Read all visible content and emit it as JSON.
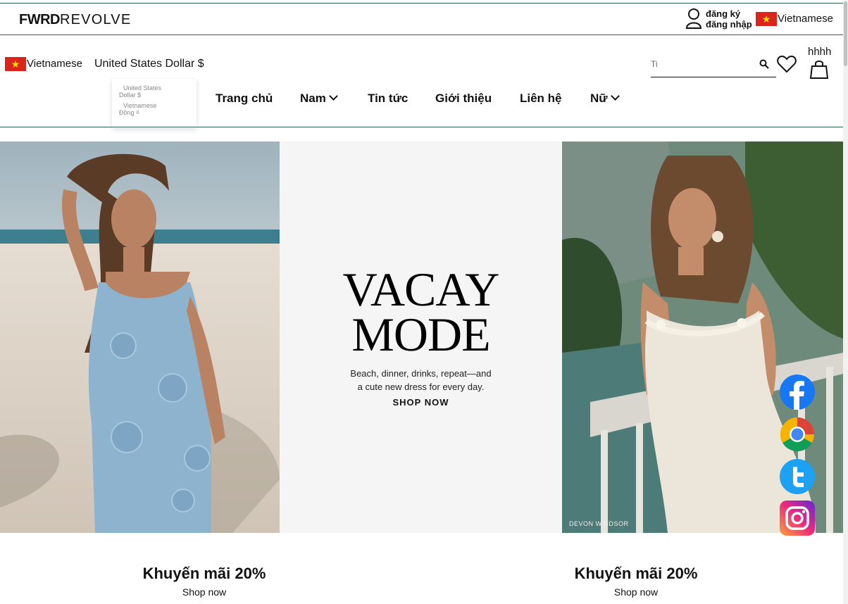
{
  "header": {
    "logo_bold": "FWRD",
    "logo_light": "REVOLVE",
    "register": "đăng ký",
    "login": "đăng nhập",
    "language": "Vietnamese"
  },
  "toolbar": {
    "language": "Vietnamese",
    "currency": "United States Dollar $",
    "currency_options": [
      "United States",
      "Dollar $",
      "Vietnamese",
      "Đồng ₫"
    ],
    "search_value": "Ti",
    "cart_name": "hhhh"
  },
  "nav": {
    "items": [
      {
        "label": "Trang chủ"
      },
      {
        "label": "Nam"
      },
      {
        "label": "Tin tức"
      },
      {
        "label": "Giới thiệu"
      },
      {
        "label": "Liên hệ"
      },
      {
        "label": "Nữ"
      }
    ]
  },
  "hero": {
    "title_line1": "VACAY",
    "title_line2": "MODE",
    "subtitle_line1": "Beach, dinner, drinks, repeat—and",
    "subtitle_line2": "a cute new dress for every day.",
    "cta": "SHOP NOW",
    "credit": "DEVON WINDSOR"
  },
  "promos": [
    {
      "title": "Khuyến mãi 20%",
      "link": "Shop now"
    },
    {
      "title": "Khuyến mãi 20%",
      "link": "Shop now"
    }
  ],
  "social": [
    "facebook-icon",
    "chrome-icon",
    "twitter-icon",
    "instagram-icon"
  ],
  "colors": {
    "flag_red": "#da251d",
    "flag_star": "#ffde00",
    "divider": "#2f5f55",
    "facebook": "#1877f2",
    "twitter": "#1da1f2"
  }
}
